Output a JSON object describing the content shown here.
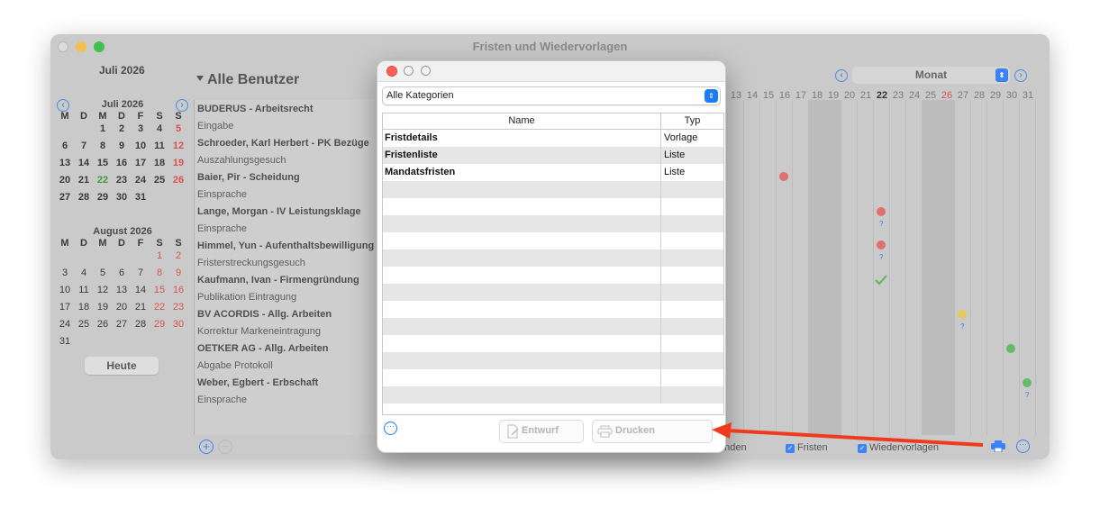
{
  "window": {
    "title": "Fristen und Wiedervorlagen"
  },
  "sidebar": {
    "header_month": "Juli 2026",
    "cal1": {
      "title": "Juli 2026",
      "weekdays": [
        "M",
        "D",
        "M",
        "D",
        "F",
        "S",
        "S"
      ],
      "rows": [
        [
          "",
          "",
          "1",
          "2",
          "3",
          "4",
          "5"
        ],
        [
          "6",
          "7",
          "8",
          "9",
          "10",
          "11",
          "12"
        ],
        [
          "13",
          "14",
          "15",
          "16",
          "17",
          "18",
          "19"
        ],
        [
          "20",
          "21",
          "22",
          "23",
          "24",
          "25",
          "26"
        ],
        [
          "27",
          "28",
          "29",
          "30",
          "31",
          "",
          ""
        ]
      ]
    },
    "cal2": {
      "title": "August 2026",
      "weekdays": [
        "M",
        "D",
        "M",
        "D",
        "F",
        "S",
        "S"
      ],
      "rows": [
        [
          "",
          "",
          "",
          "",
          "",
          "1",
          "2"
        ],
        [
          "3",
          "4",
          "5",
          "6",
          "7",
          "8",
          "9"
        ],
        [
          "10",
          "11",
          "12",
          "13",
          "14",
          "15",
          "16"
        ],
        [
          "17",
          "18",
          "19",
          "20",
          "21",
          "22",
          "23"
        ],
        [
          "24",
          "25",
          "26",
          "27",
          "28",
          "29",
          "30"
        ],
        [
          "31",
          "",
          "",
          "",
          "",
          "",
          ""
        ]
      ]
    },
    "today_button": "Heute"
  },
  "users": {
    "title": "Alle Benutzer",
    "items": [
      {
        "text": "BUDERUS - Arbeitsrecht",
        "bold": true
      },
      {
        "text": "Eingabe",
        "bold": false
      },
      {
        "text": "Schroeder, Karl Herbert - PK Bezüge",
        "bold": true
      },
      {
        "text": "Auszahlungsgesuch",
        "bold": false
      },
      {
        "text": "Baier, Pir - Scheidung",
        "bold": true
      },
      {
        "text": "Einsprache",
        "bold": false
      },
      {
        "text": "Lange, Morgan - IV Leistungsklage",
        "bold": true
      },
      {
        "text": "Einsprache",
        "bold": false
      },
      {
        "text": "Himmel, Yun - Aufenthaltsbewilligung",
        "bold": true
      },
      {
        "text": "Fristerstreckungsgesuch",
        "bold": false
      },
      {
        "text": "Kaufmann, Ivan - Firmengründung",
        "bold": true
      },
      {
        "text": "Publikation Eintragung",
        "bold": false
      },
      {
        "text": "BV ACORDIS - Allg. Arbeiten",
        "bold": true
      },
      {
        "text": "Korrektur Markeneintragung",
        "bold": false
      },
      {
        "text": "OETKER AG - Allg. Arbeiten",
        "bold": true
      },
      {
        "text": "Abgabe Protokoll",
        "bold": false
      },
      {
        "text": "Weber, Egbert - Erbschaft",
        "bold": true
      },
      {
        "text": "Einsprache",
        "bold": false
      }
    ]
  },
  "timeline": {
    "view_select": "Monat",
    "days": [
      "13",
      "14",
      "15",
      "16",
      "17",
      "18",
      "19",
      "20",
      "21",
      "22",
      "23",
      "24",
      "25",
      "26",
      "27",
      "28",
      "29",
      "30",
      "31"
    ]
  },
  "bottom": {
    "partial_label": "enden",
    "fristen_label": "Fristen",
    "wiedervorlagen_label": "Wiedervorlagen"
  },
  "dialog": {
    "category": "Alle Kategorien",
    "col_name": "Name",
    "col_type": "Typ",
    "rows": [
      {
        "name": "Fristdetails",
        "type": "Vorlage"
      },
      {
        "name": "Fristenliste",
        "type": "Liste"
      },
      {
        "name": "Mandatsfristen",
        "type": "Liste"
      }
    ],
    "draft_button": "Entwurf",
    "print_button": "Drucken"
  },
  "colors": {
    "accent": "#3b82f6",
    "red_dot": "#e07070",
    "yellow_dot": "#e8c860",
    "green_dot": "#66bb6a",
    "arrow": "#f03a1e"
  }
}
